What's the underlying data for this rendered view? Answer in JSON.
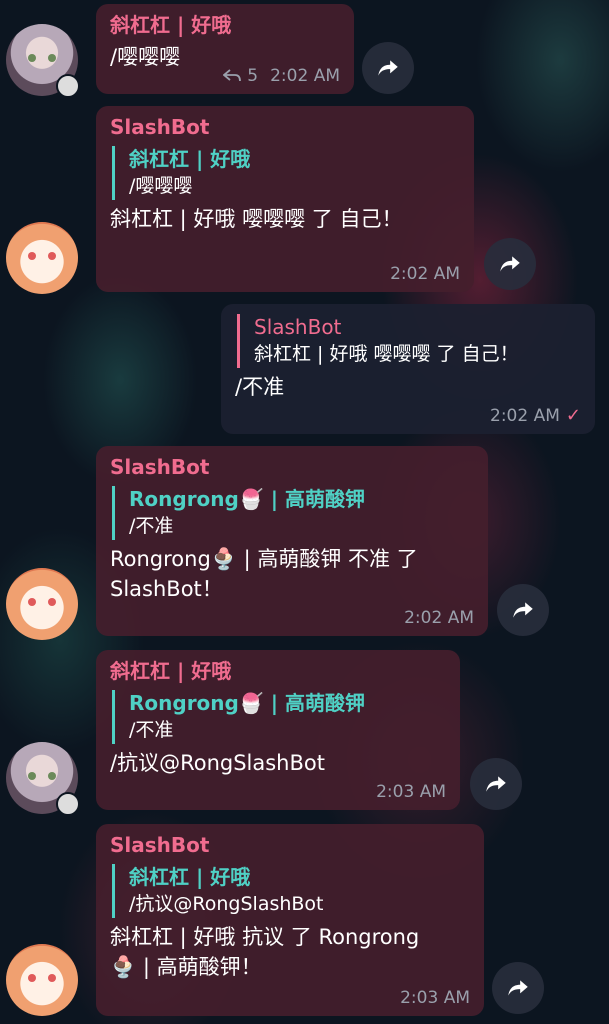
{
  "messages": [
    {
      "sender": "斜杠杠 | 好哦",
      "text": "/嘤嘤嘤",
      "replies": "5",
      "time": "2:02 AM"
    },
    {
      "sender": "SlashBot",
      "quote_name": "斜杠杠 | 好哦",
      "quote_text": "/嘤嘤嘤",
      "text": "斜杠杠 | 好哦 嘤嘤嘤 了 自己！",
      "time": "2:02 AM"
    },
    {
      "quote_name": "SlashBot",
      "quote_text": "斜杠杠 | 好哦 嘤嘤嘤 了 自己！",
      "text": "/不准",
      "time": "2:02 AM",
      "status": "✓"
    },
    {
      "sender": "SlashBot",
      "quote_name": "Rongrong🍧 | 高萌酸钾",
      "quote_text": "/不准",
      "text": "Rongrong🍨 | 高萌酸钾 不准 了\nSlashBot！",
      "time": "2:02 AM"
    },
    {
      "sender": "斜杠杠 | 好哦",
      "quote_name": "Rongrong🍧 | 高萌酸钾",
      "quote_text": "/不准",
      "text": "/抗议@RongSlashBot",
      "time": "2:03 AM"
    },
    {
      "sender": "SlashBot",
      "quote_name": "斜杠杠 | 好哦",
      "quote_text": "/抗议@RongSlashBot",
      "text": "斜杠杠 | 好哦 抗议 了 Rongrong\n🍨 | 高萌酸钾！",
      "time": "2:03 AM"
    }
  ],
  "icons": {
    "forward": "forward-arrow-icon",
    "reply": "reply-arrow-icon",
    "read": "check-icon"
  },
  "colors": {
    "accent": "#f06c8f",
    "quote": "#4fd1c5"
  }
}
